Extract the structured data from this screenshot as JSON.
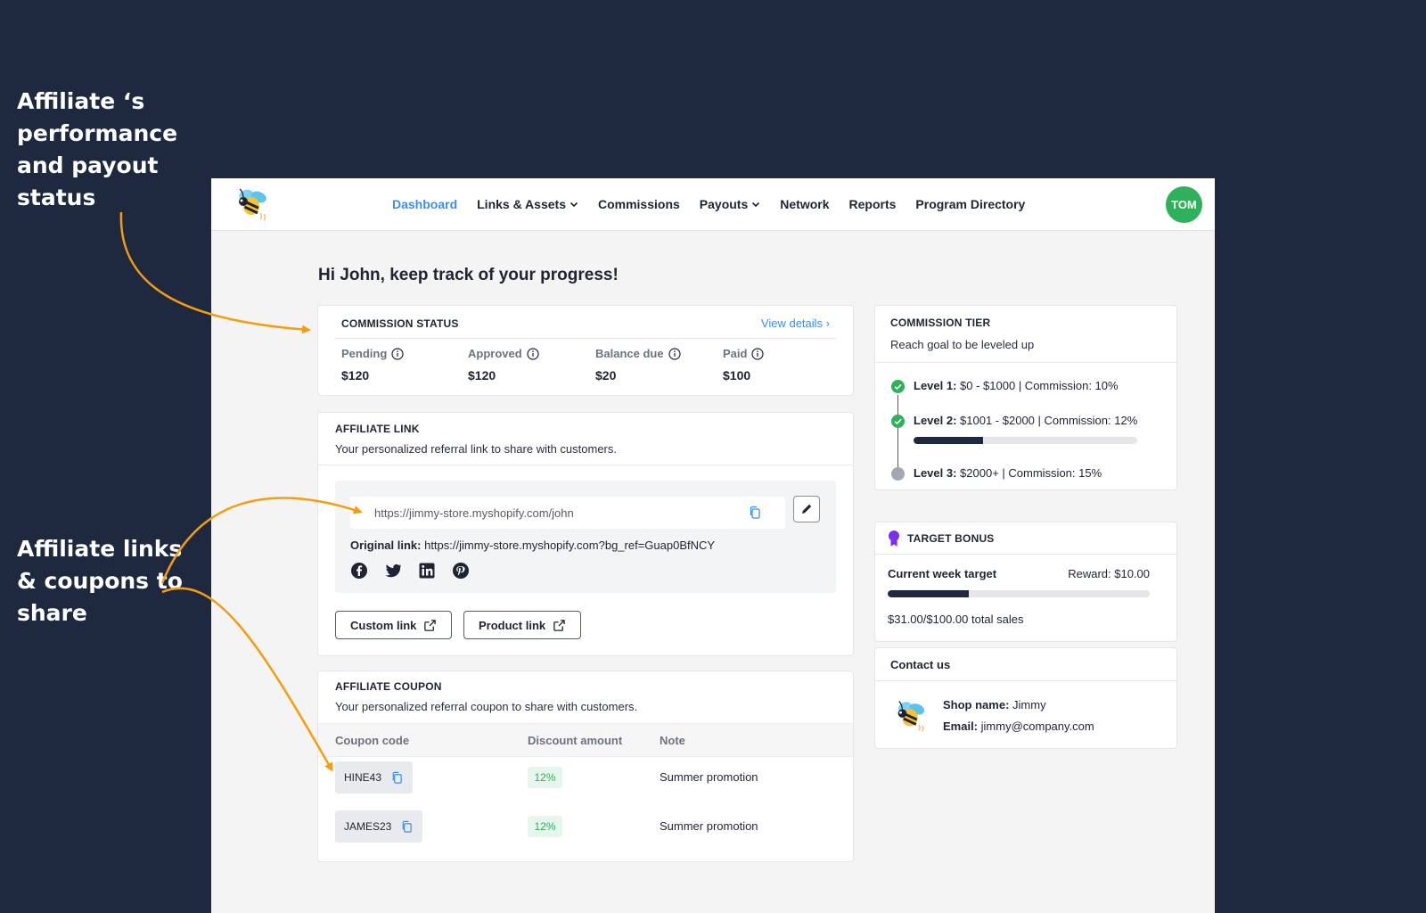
{
  "callouts": {
    "performance": "Affiliate ‘s performance and payout status",
    "links": "Affiliate links & coupons to share"
  },
  "nav": {
    "items": [
      {
        "label": "Dashboard",
        "active": true
      },
      {
        "label": "Links & Assets",
        "dropdown": true
      },
      {
        "label": "Commissions"
      },
      {
        "label": "Payouts",
        "dropdown": true
      },
      {
        "label": "Network"
      },
      {
        "label": "Reports"
      },
      {
        "label": "Program Directory"
      }
    ],
    "avatar": "TOM"
  },
  "greeting": "Hi John, keep track of your progress!",
  "commission_status": {
    "title": "COMMISSION STATUS",
    "view_details": "View details ›",
    "stats": [
      {
        "label": "Pending",
        "value": "$120"
      },
      {
        "label": "Approved",
        "value": "$120"
      },
      {
        "label": "Balance due",
        "value": "$20"
      },
      {
        "label": "Paid",
        "value": "$100"
      }
    ]
  },
  "affiliate_link": {
    "title": "AFFILIATE LINK",
    "subtitle": "Your personalized referral link to share with customers.",
    "url": "https://jimmy-store.myshopify.com/john",
    "original_label": "Original link:",
    "original_url": "https://jimmy-store.myshopify.com?bg_ref=Guap0BfNCY",
    "socials": [
      "facebook-icon",
      "twitter-icon",
      "linkedin-icon",
      "pinterest-icon"
    ],
    "custom_link": "Custom link",
    "product_link": "Product link"
  },
  "affiliate_coupon": {
    "title": "AFFILIATE COUPON",
    "subtitle": "Your personalized referral coupon to share with customers.",
    "columns": [
      "Coupon code",
      "Discount amount",
      "Note"
    ],
    "rows": [
      {
        "code": "HINE43",
        "discount": "12%",
        "note": "Summer promotion"
      },
      {
        "code": "JAMES23",
        "discount": "12%",
        "note": "Summer promotion"
      }
    ]
  },
  "commission_tier": {
    "title": "COMMISSION TIER",
    "subtitle": "Reach goal to be leveled up",
    "levels": [
      {
        "name": "Level 1:",
        "detail": "$0 - $1000 | Commission: 10%",
        "done": true
      },
      {
        "name": "Level 2:",
        "detail": "$1001 - $2000 | Commission: 12%",
        "done": true,
        "progress": 0.31
      },
      {
        "name": "Level 3:",
        "detail": "$2000+ | Commission: 15%",
        "done": false
      }
    ]
  },
  "target_bonus": {
    "title": "TARGET BONUS",
    "target_label": "Current week target",
    "reward": "Reward: $10.00",
    "progress": 0.31,
    "total": "$31.00/$100.00 total sales"
  },
  "contact": {
    "title": "Contact us",
    "shop_label": "Shop name:",
    "shop_name": "Jimmy",
    "email_label": "Email:",
    "email": "jimmy@company.com"
  },
  "colors": {
    "background": "#1e2940",
    "accent": "#3b8fe6",
    "success": "#2fb05a",
    "arrow": "#f59d0f"
  }
}
